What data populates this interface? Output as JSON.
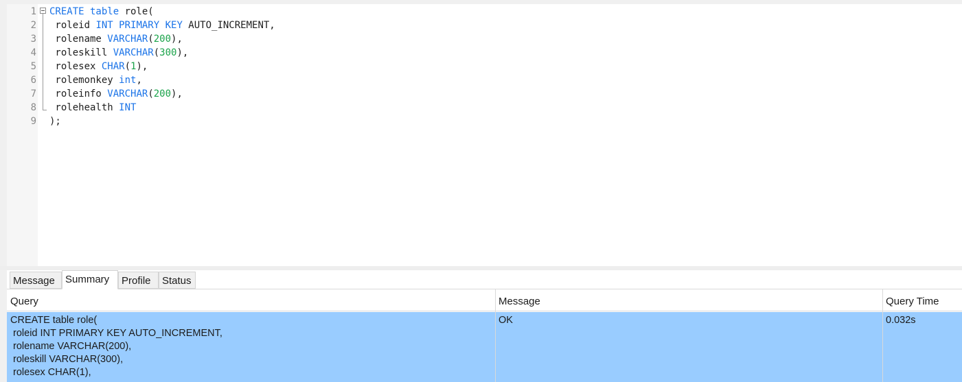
{
  "editor": {
    "line_numbers": [
      "1",
      "2",
      "3",
      "4",
      "5",
      "6",
      "7",
      "8",
      "9"
    ],
    "code_lines": [
      [
        {
          "t": "CREATE table ",
          "c": "kw"
        },
        {
          "t": "role(",
          "c": "plain"
        }
      ],
      [
        {
          "t": " roleid ",
          "c": "plain"
        },
        {
          "t": "INT PRIMARY KEY",
          "c": "kw"
        },
        {
          "t": " AUTO_INCREMENT,",
          "c": "plain"
        }
      ],
      [
        {
          "t": " rolename ",
          "c": "plain"
        },
        {
          "t": "VARCHAR",
          "c": "kw"
        },
        {
          "t": "(",
          "c": "plain"
        },
        {
          "t": "200",
          "c": "num"
        },
        {
          "t": "),",
          "c": "plain"
        }
      ],
      [
        {
          "t": " roleskill ",
          "c": "plain"
        },
        {
          "t": "VARCHAR",
          "c": "kw"
        },
        {
          "t": "(",
          "c": "plain"
        },
        {
          "t": "300",
          "c": "num"
        },
        {
          "t": "),",
          "c": "plain"
        }
      ],
      [
        {
          "t": " rolesex ",
          "c": "plain"
        },
        {
          "t": "CHAR",
          "c": "kw"
        },
        {
          "t": "(",
          "c": "plain"
        },
        {
          "t": "1",
          "c": "num"
        },
        {
          "t": "),",
          "c": "plain"
        }
      ],
      [
        {
          "t": " rolemonkey ",
          "c": "plain"
        },
        {
          "t": "int",
          "c": "kw"
        },
        {
          "t": ",",
          "c": "plain"
        }
      ],
      [
        {
          "t": " roleinfo ",
          "c": "plain"
        },
        {
          "t": "VARCHAR",
          "c": "kw"
        },
        {
          "t": "(",
          "c": "plain"
        },
        {
          "t": "200",
          "c": "num"
        },
        {
          "t": "),",
          "c": "plain"
        }
      ],
      [
        {
          "t": " rolehealth ",
          "c": "plain"
        },
        {
          "t": "INT",
          "c": "kw"
        }
      ],
      [
        {
          "t": ");",
          "c": "plain"
        }
      ]
    ]
  },
  "tabs": {
    "message": "Message",
    "summary": "Summary",
    "profile": "Profile",
    "status": "Status"
  },
  "results": {
    "headers": {
      "query": "Query",
      "message": "Message",
      "query_time": "Query Time"
    },
    "row": {
      "query": "CREATE table role(\n roleid INT PRIMARY KEY AUTO_INCREMENT,\n rolename VARCHAR(200),\n roleskill VARCHAR(300),\n rolesex CHAR(1),",
      "message": "OK",
      "query_time": "0.032s"
    }
  },
  "colors": {
    "keyword": "#1a73e8",
    "number": "#1aa34a",
    "selected_row": "#99ccff"
  }
}
